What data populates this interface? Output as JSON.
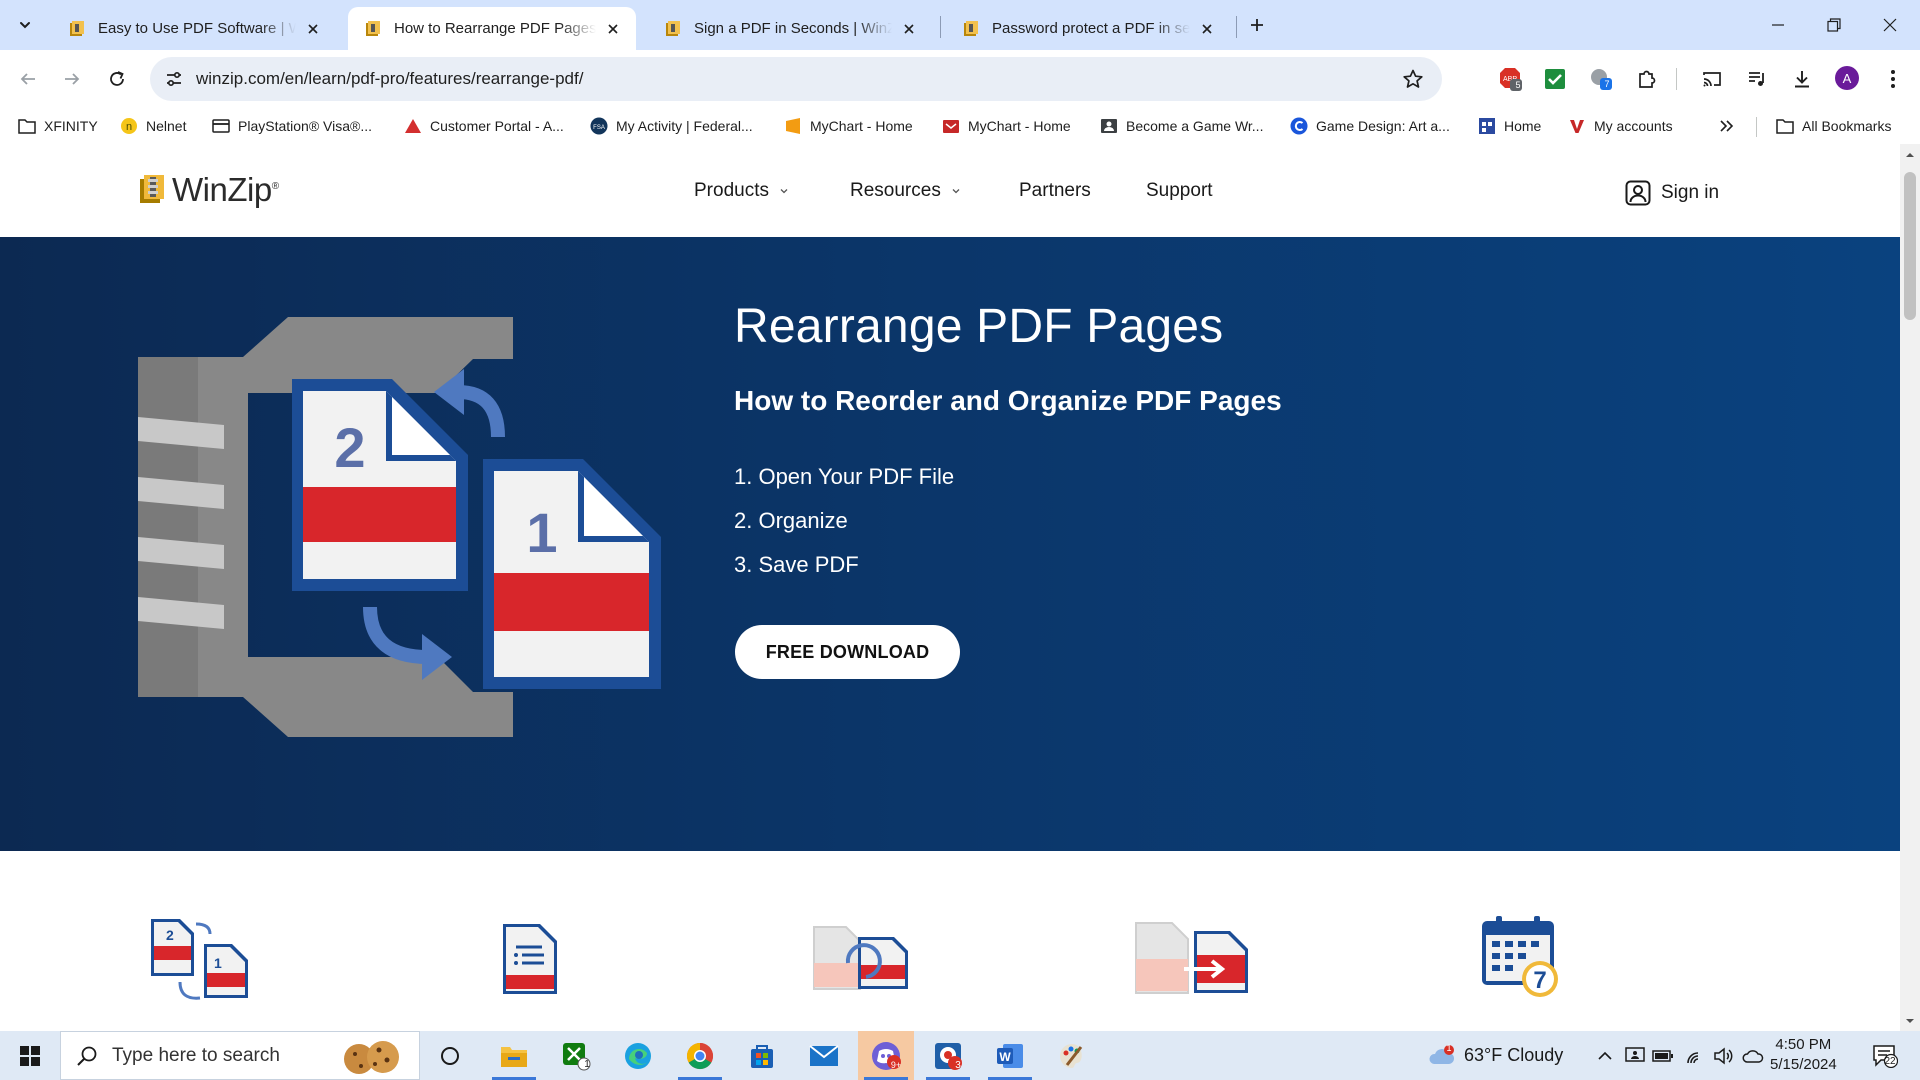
{
  "browser": {
    "tabs": [
      {
        "title": "Easy to Use PDF Software | Win",
        "active": false
      },
      {
        "title": "How to Rearrange PDF Pages | W",
        "active": true
      },
      {
        "title": "Sign a PDF in Seconds | WinZip",
        "active": false
      },
      {
        "title": "Password protect a PDF in seco",
        "active": false
      }
    ],
    "url": "winzip.com/en/learn/pdf-pro/features/rearrange-pdf/",
    "extension_badges": {
      "adblock": "5",
      "cloud": "7"
    },
    "profile_initial": "A",
    "bookmarks": [
      {
        "label": "XFINITY",
        "icon": "folder-icon"
      },
      {
        "label": "Nelnet",
        "icon": "nelnet-icon"
      },
      {
        "label": "PlayStation® Visa®...",
        "icon": "card-icon"
      },
      {
        "label": "Customer Portal - A...",
        "icon": "triangle-logo-icon"
      },
      {
        "label": "My Activity | Federal...",
        "icon": "fsa-icon"
      },
      {
        "label": "MyChart - Home",
        "icon": "mychart-icon"
      },
      {
        "label": "MyChart - Home",
        "icon": "mychart-red-icon"
      },
      {
        "label": "Become a Game Wr...",
        "icon": "badge-icon"
      },
      {
        "label": "Game Design: Art a...",
        "icon": "c-logo-icon"
      },
      {
        "label": "Home",
        "icon": "calendar-grid-icon"
      },
      {
        "label": "My accounts",
        "icon": "v-logo-icon"
      }
    ],
    "all_bookmarks_label": "All Bookmarks"
  },
  "site": {
    "logo_text": "WinZip",
    "logo_mark": "®",
    "nav": [
      {
        "label": "Products",
        "has_dropdown": true
      },
      {
        "label": "Resources",
        "has_dropdown": true
      },
      {
        "label": "Partners",
        "has_dropdown": false
      },
      {
        "label": "Support",
        "has_dropdown": false
      }
    ],
    "sign_in_label": "Sign in"
  },
  "hero": {
    "title": "Rearrange PDF Pages",
    "subtitle": "How to Reorder and Organize PDF Pages",
    "steps": [
      "1. Open Your PDF File",
      "2. Organize",
      "3. Save PDF"
    ],
    "cta_label": "FREE DOWNLOAD",
    "art_page_numbers": [
      "2",
      "1"
    ]
  },
  "features": {
    "icons": [
      "reorder-pages-icon",
      "document-list-icon",
      "rotate-pages-icon",
      "convert-pages-icon",
      "calendar-trial-icon"
    ],
    "calendar_number": "7"
  },
  "taskbar": {
    "search_placeholder": "Type here to search",
    "weather": "63°F  Cloudy",
    "weather_badge": "1",
    "time": "4:50 PM",
    "date": "5/15/2024",
    "notification_count": "22",
    "app_badges": {
      "xbox": "1",
      "discord": "9+",
      "chrome_ext": "3"
    }
  },
  "colors": {
    "tab_strip": "#d3e3fd",
    "hero_dark": "#0c2952",
    "hero_light": "#0a427f",
    "pdf_red": "#d8262b",
    "pdf_blue": "#1c4d96",
    "clamp_gray": "#8a8a8a"
  }
}
